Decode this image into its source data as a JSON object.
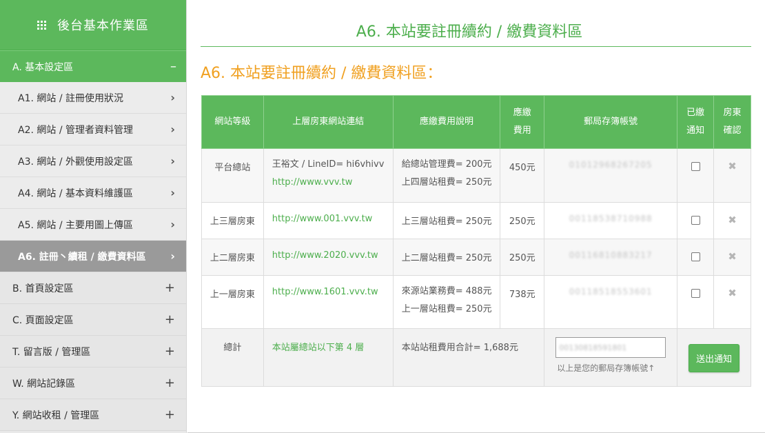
{
  "sidebar": {
    "header": "後台基本作業區",
    "section": {
      "label": "A. 基本設定區",
      "toggle": "–"
    },
    "items": [
      {
        "label": "A1. 網站 / 註冊使用狀況"
      },
      {
        "label": "A2. 網站 / 管理者資料管理"
      },
      {
        "label": "A3. 網站 / 外觀使用設定區"
      },
      {
        "label": "A4. 網站 / 基本資料維護區"
      },
      {
        "label": "A5. 網站 / 主要用圖上傳區"
      },
      {
        "label": "A6. 註冊丶續租 / 繳費資料區"
      }
    ],
    "categories": [
      {
        "label": "B. 首頁設定區"
      },
      {
        "label": "C. 頁面設定區"
      },
      {
        "label": "T. 留言版 / 管理區"
      },
      {
        "label": "W. 網站記錄區"
      },
      {
        "label": "Y. 網站收租 / 管理區"
      }
    ],
    "chevron": "›",
    "plus": "+"
  },
  "main": {
    "title": "A6. 本站要註冊續約 / 繳費資料區",
    "subtitle": "A6. 本站要註冊續約 / 繳費資料區："
  },
  "table": {
    "headers": {
      "level": "網站等級",
      "link": "上層房東網站連結",
      "desc": "應繳費用說明",
      "fee_line1": "應繳",
      "fee_line2": "費用",
      "account": "郵局存簿帳號",
      "notified_line1": "已繳",
      "notified_line2": "通知",
      "confirm_line1": "房東",
      "confirm_line2": "確認"
    },
    "rows": [
      {
        "level": "平台總站",
        "owner": "王裕文 / LineID= hi6vhivv",
        "url": "http://www.vvv.tw",
        "desc1": "給總站管理費= 200元",
        "desc2": "上四層站租費= 250元",
        "fee": "450元",
        "account": "01012968267205"
      },
      {
        "level": "上三層房東",
        "url": "http://www.001.vvv.tw",
        "desc1": "上三層站租費= 250元",
        "fee": "250元",
        "account": "00118538710988"
      },
      {
        "level": "上二層房東",
        "url": "http://www.2020.vvv.tw",
        "desc1": "上二層站租費= 250元",
        "fee": "250元",
        "account": "00116810883217"
      },
      {
        "level": "上一層房東",
        "url": "http://www.1601.vvv.tw",
        "desc1": "來源站業務費= 488元",
        "desc2": "上一層站租費= 250元",
        "fee": "738元",
        "account": "00118518553601"
      }
    ],
    "total": {
      "label": "總計",
      "position": "本站屬總站以下第 4 層",
      "sum": "本站站租費用合計= 1,688元",
      "input_value": "00130818591801",
      "hint": "以上是您的郵局存簿帳號↑",
      "button": "送出通知"
    },
    "delete_glyph": "✖"
  },
  "colors": {
    "accent": "#5cb85c",
    "orange": "#f0a020"
  }
}
